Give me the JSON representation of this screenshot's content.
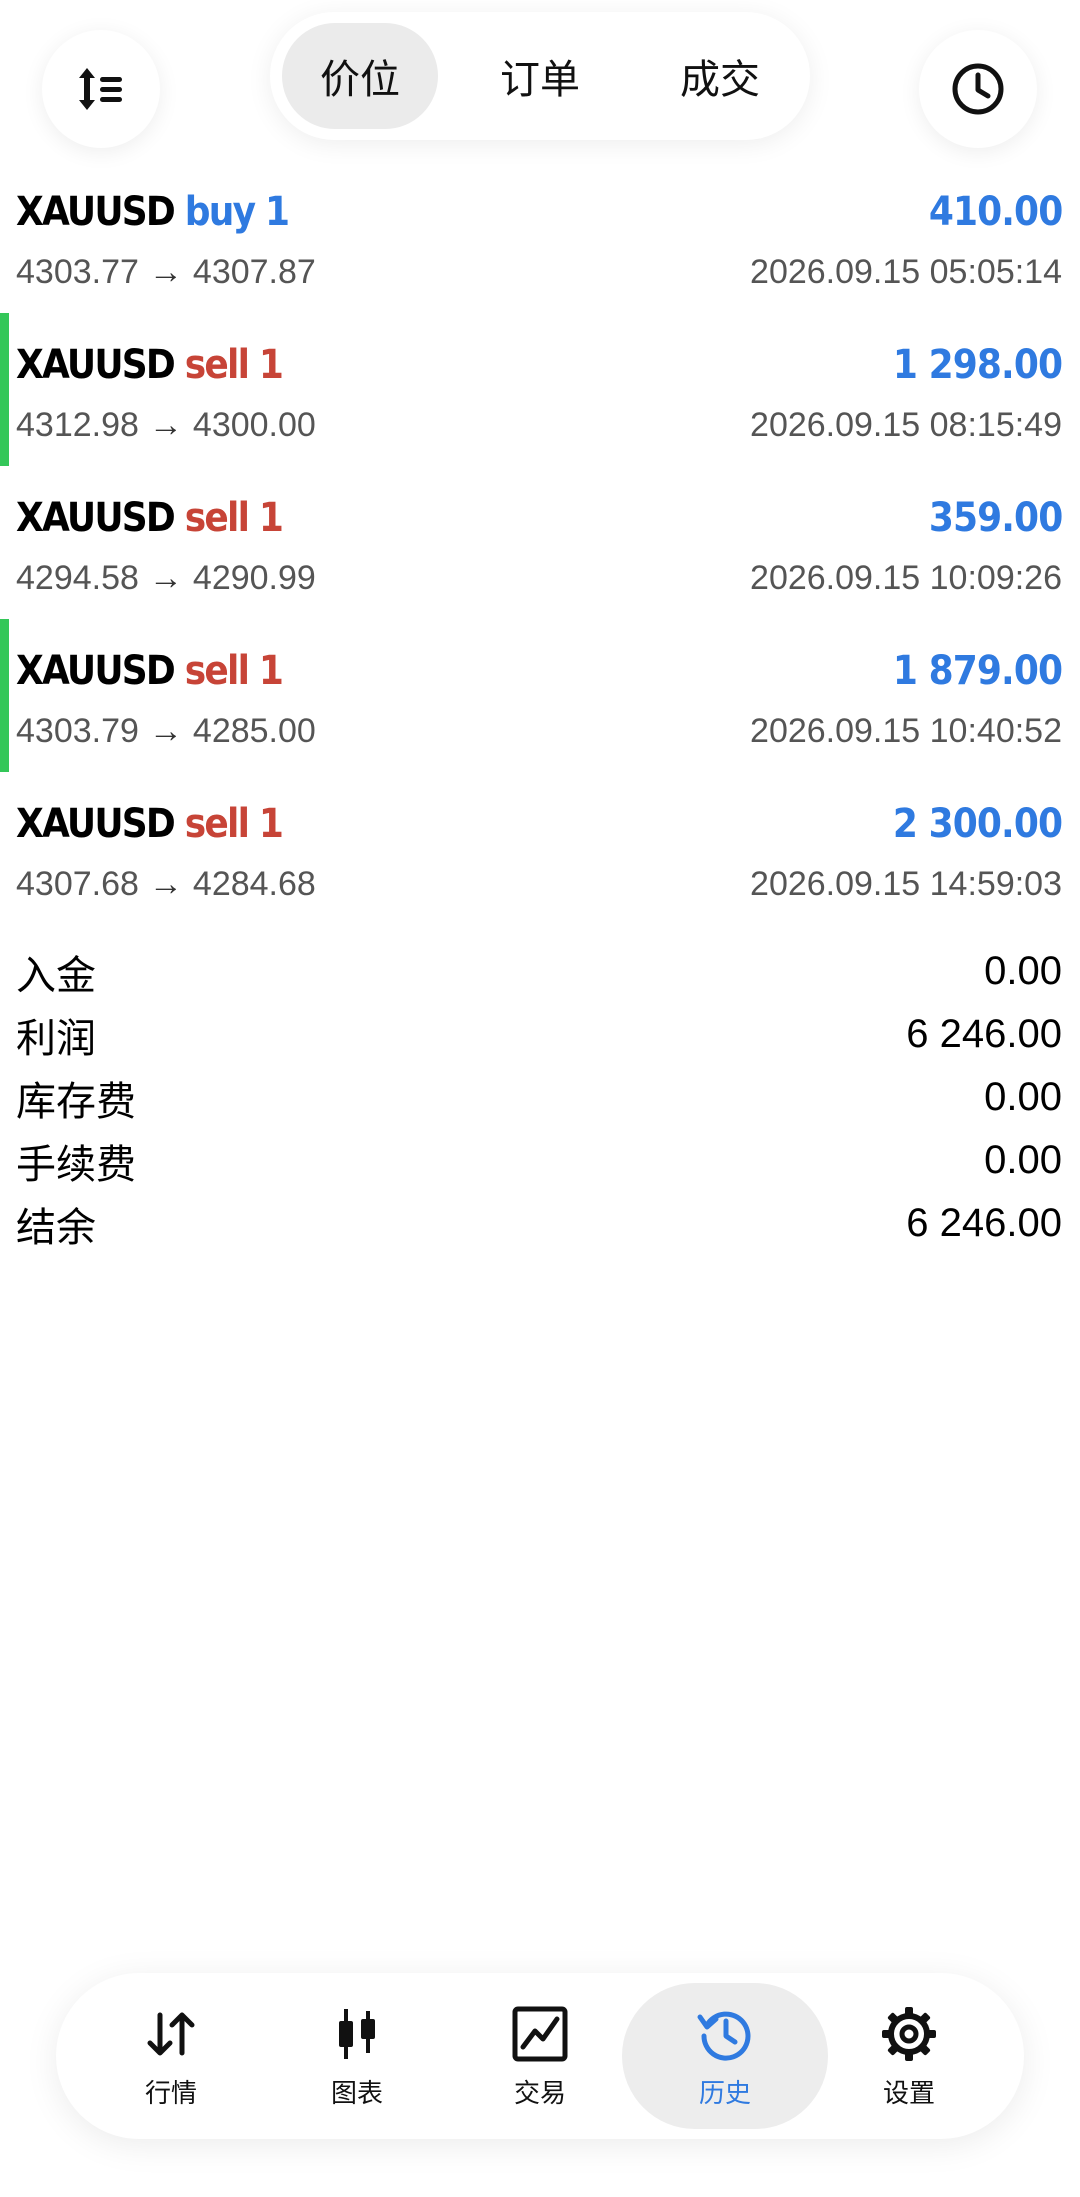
{
  "topbar": {
    "tabs": [
      {
        "label": "价位",
        "active": true
      },
      {
        "label": "订单",
        "active": false
      },
      {
        "label": "成交",
        "active": false
      }
    ],
    "left_icon": "sort-icon",
    "right_icon": "clock-icon"
  },
  "trades": [
    {
      "symbol": "XAUUSD",
      "direction": "buy 1",
      "side": "buy",
      "profit": "410.00",
      "open_price": "4303.77",
      "close_price": "4307.87",
      "time": "2026.09.15 05:05:14",
      "highlight": false
    },
    {
      "symbol": "XAUUSD",
      "direction": "sell 1",
      "side": "sell",
      "profit": "1 298.00",
      "open_price": "4312.98",
      "close_price": "4300.00",
      "time": "2026.09.15 08:15:49",
      "highlight": true
    },
    {
      "symbol": "XAUUSD",
      "direction": "sell 1",
      "side": "sell",
      "profit": "359.00",
      "open_price": "4294.58",
      "close_price": "4290.99",
      "time": "2026.09.15 10:09:26",
      "highlight": false
    },
    {
      "symbol": "XAUUSD",
      "direction": "sell 1",
      "side": "sell",
      "profit": "1 879.00",
      "open_price": "4303.79",
      "close_price": "4285.00",
      "time": "2026.09.15 10:40:52",
      "highlight": true
    },
    {
      "symbol": "XAUUSD",
      "direction": "sell 1",
      "side": "sell",
      "profit": "2 300.00",
      "open_price": "4307.68",
      "close_price": "4284.68",
      "time": "2026.09.15 14:59:03",
      "highlight": false
    }
  ],
  "arrow": "→",
  "summary": [
    {
      "label": "入金",
      "value": "0.00"
    },
    {
      "label": "利润",
      "value": "6 246.00"
    },
    {
      "label": "库存费",
      "value": "0.00"
    },
    {
      "label": "手续费",
      "value": "0.00"
    },
    {
      "label": "结余",
      "value": "6 246.00"
    }
  ],
  "bottom_nav": [
    {
      "label": "行情",
      "icon": "quotes-arrows-icon",
      "active": false
    },
    {
      "label": "图表",
      "icon": "candlestick-chart-icon",
      "active": false
    },
    {
      "label": "交易",
      "icon": "trade-chart-icon",
      "active": false
    },
    {
      "label": "历史",
      "icon": "history-icon",
      "active": true
    },
    {
      "label": "设置",
      "icon": "gear-icon",
      "active": false
    }
  ],
  "colors": {
    "accent_blue": "#2f7ae0",
    "sell_red": "#c74437",
    "highlight_green": "#34c759"
  }
}
